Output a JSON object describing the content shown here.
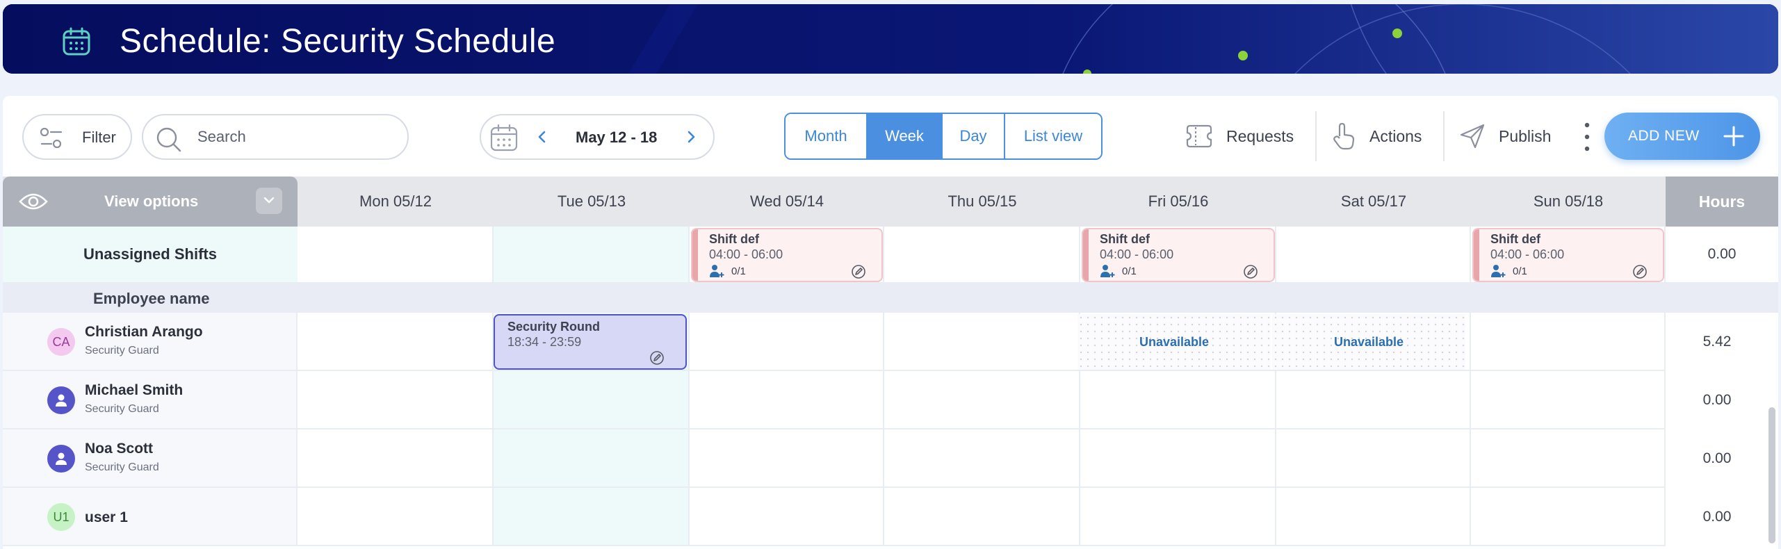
{
  "header": {
    "title": "Schedule: Security Schedule",
    "icon": "calendar-icon"
  },
  "toolbar": {
    "filter_label": "Filter",
    "search_placeholder": "Search",
    "date_range": "May 12 - 18",
    "view_tabs": [
      "Month",
      "Week",
      "Day",
      "List view"
    ],
    "active_view": "Week",
    "requests_label": "Requests",
    "actions_label": "Actions",
    "publish_label": "Publish",
    "add_new_label": "ADD NEW"
  },
  "grid": {
    "view_options_label": "View options",
    "days": [
      "Mon 05/12",
      "Tue 05/13",
      "Wed 05/14",
      "Thu 05/15",
      "Fri 05/16",
      "Sat 05/17",
      "Sun 05/18"
    ],
    "hours_label": "Hours",
    "unassigned": {
      "label": "Unassigned Shifts",
      "hours": "0.00",
      "shifts": [
        {
          "day": "Wed 05/14",
          "title": "Shift def",
          "time": "04:00 - 06:00",
          "count": "0/1"
        },
        {
          "day": "Fri 05/16",
          "title": "Shift def",
          "time": "04:00 - 06:00",
          "count": "0/1"
        },
        {
          "day": "Sun 05/18",
          "title": "Shift def",
          "time": "04:00 - 06:00",
          "count": "0/1"
        }
      ]
    },
    "employee_name_label": "Employee name",
    "employees": [
      {
        "initials": "CA",
        "name": "Christian Arango",
        "role": "Security Guard",
        "hours": "5.42"
      },
      {
        "initials": "",
        "name": "Michael Smith",
        "role": "Security Guard",
        "hours": "0.00"
      },
      {
        "initials": "",
        "name": "Noa Scott",
        "role": "Security Guard",
        "hours": "0.00"
      },
      {
        "initials": "U1",
        "name": "user 1",
        "role": "",
        "hours": "0.00"
      }
    ],
    "round_shift": {
      "title": "Security Round",
      "time": "18:34 - 23:59"
    },
    "unavailable_label": "Unavailable"
  },
  "colors": {
    "header_bg": "#050d5e",
    "accent": "#4a90e2",
    "highlight_column": "#eefaf9",
    "shift_round": "#d7d8f5",
    "avatar_user": "#5554c9"
  }
}
